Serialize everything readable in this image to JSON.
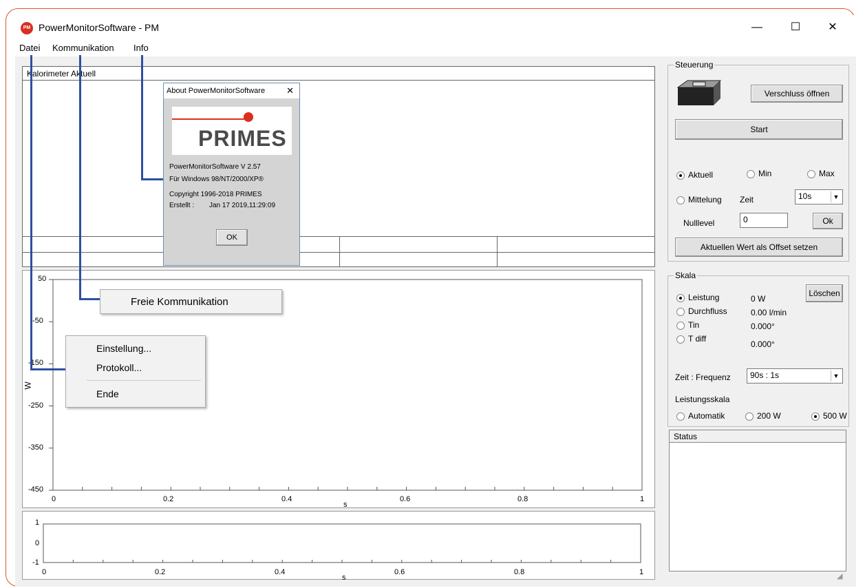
{
  "window": {
    "title": "PowerMonitorSoftware - PM",
    "icon_text": "PM",
    "minimize": "—",
    "maximize": "☐",
    "close": "✕"
  },
  "menubar": [
    "Datei",
    "Kommunikation",
    "Info"
  ],
  "kalorimeter": {
    "header": "Kalorimeter Aktuell"
  },
  "chart_main": {
    "ylabel": "W",
    "xlabel": "s",
    "yticks": [
      "50",
      "-50",
      "-150",
      "-250",
      "-350",
      "-450"
    ],
    "xticks": [
      "0",
      "0.2",
      "0.4",
      "0.6",
      "0.8",
      "1"
    ]
  },
  "chart_small": {
    "xlabel": "s",
    "yticks": [
      "1",
      "0",
      "-1"
    ],
    "xticks": [
      "0",
      "0.2",
      "0.4",
      "0.6",
      "0.8",
      "1"
    ]
  },
  "about_dialog": {
    "title": "About PowerMonitorSoftware",
    "close": "✕",
    "logo_text": "PRIMES",
    "version": "PowerMonitorSoftware V 2.57",
    "platform": "Für Windows 98/NT/2000/XP®",
    "copyright": "Copyright 1996-2018 PRIMES",
    "created_label": "Erstellt :",
    "created_value": "Jan 17 2019,11:29:09",
    "ok": "OK"
  },
  "kommunikation_menu": {
    "items": [
      "Freie Kommunikation"
    ]
  },
  "datei_menu": {
    "items": [
      "Einstellung...",
      "Protokoll...",
      "Ende"
    ]
  },
  "steuerung": {
    "title": "Steuerung",
    "shutter_button": "Verschluss öffnen",
    "start_button": "Start",
    "radio_aktuell": "Aktuell",
    "radio_min": "Min",
    "radio_max": "Max",
    "radio_mittelung": "Mittelung",
    "zeit_label": "Zeit",
    "zeit_value": "10s",
    "nulllevel_label": "Nulllevel",
    "nulllevel_value": "0",
    "ok_button": "Ok",
    "offset_button": "Aktuellen Wert als Offset setzen"
  },
  "skala": {
    "title": "Skala",
    "loeschen": "Löschen",
    "rows": [
      {
        "label": "Leistung",
        "value": "0 W",
        "selected": true
      },
      {
        "label": "Durchfluss",
        "value": "0.00 l/min",
        "selected": false
      },
      {
        "label": "Tin",
        "value": "0.000°",
        "selected": false
      },
      {
        "label": "T diff",
        "value": "0.000°",
        "selected": false
      }
    ],
    "zeit_frequenz_label": "Zeit : Frequenz",
    "zeit_frequenz_value": "90s : 1s",
    "leistungsskala_label": "Leistungsskala",
    "scale_automatik": "Automatik",
    "scale_200": "200 W",
    "scale_500": "500 W"
  },
  "status": {
    "title": "Status"
  }
}
